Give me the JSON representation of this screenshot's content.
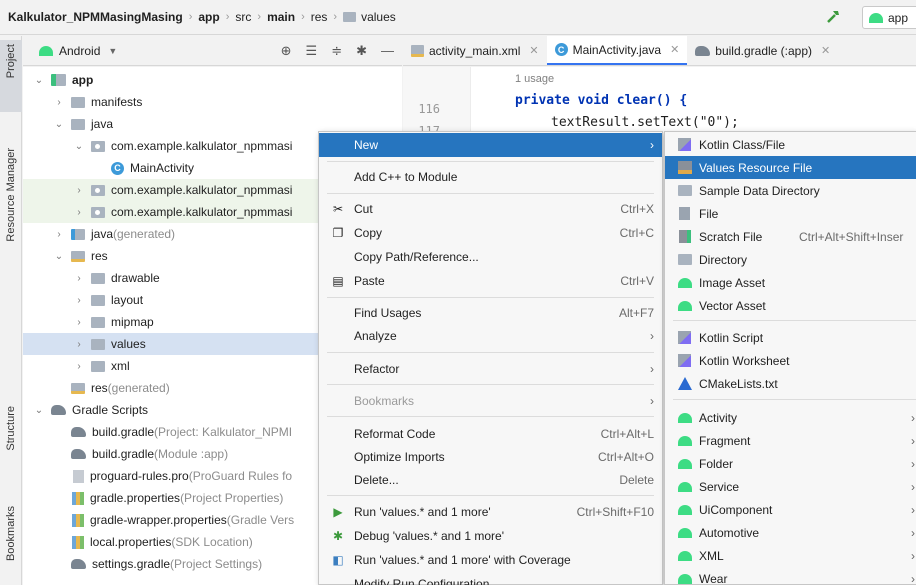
{
  "breadcrumb": {
    "project": "Kalkulator_NPMMasingMasing",
    "items": [
      "app",
      "src",
      "main",
      "res",
      "values"
    ]
  },
  "run_config": {
    "label": "app"
  },
  "side_tabs": {
    "project": "Project",
    "resource_manager": "Resource Manager",
    "structure": "Structure",
    "bookmarks": "Bookmarks"
  },
  "panel": {
    "view": "Android"
  },
  "tree": [
    {
      "label": "app",
      "extra": ""
    },
    {
      "label": "manifests",
      "extra": ""
    },
    {
      "label": "java",
      "extra": ""
    },
    {
      "label": "com.example.kalkulator_npmmasi",
      "extra": ""
    },
    {
      "label": "MainActivity",
      "extra": ""
    },
    {
      "label": "com.example.kalkulator_npmmasi",
      "extra": ""
    },
    {
      "label": "com.example.kalkulator_npmmasi",
      "extra": ""
    },
    {
      "label": "java",
      "extra": " (generated)"
    },
    {
      "label": "res",
      "extra": ""
    },
    {
      "label": "drawable",
      "extra": ""
    },
    {
      "label": "layout",
      "extra": ""
    },
    {
      "label": "mipmap",
      "extra": ""
    },
    {
      "label": "values",
      "extra": ""
    },
    {
      "label": "xml",
      "extra": ""
    },
    {
      "label": "res",
      "extra": " (generated)"
    },
    {
      "label": "Gradle Scripts",
      "extra": ""
    },
    {
      "label": "build.gradle",
      "extra": " (Project: Kalkulator_NPMI"
    },
    {
      "label": "build.gradle",
      "extra": " (Module :app)"
    },
    {
      "label": "proguard-rules.pro",
      "extra": " (ProGuard Rules fo"
    },
    {
      "label": "gradle.properties",
      "extra": " (Project Properties)"
    },
    {
      "label": "gradle-wrapper.properties",
      "extra": " (Gradle Vers"
    },
    {
      "label": "local.properties",
      "extra": " (SDK Location)"
    },
    {
      "label": "settings.gradle",
      "extra": " (Project Settings)"
    }
  ],
  "tabs": [
    {
      "label": "activity_main.xml"
    },
    {
      "label": "MainActivity.java"
    },
    {
      "label": "build.gradle (:app)"
    }
  ],
  "editor": {
    "usage": "1 usage",
    "line_116": "116",
    "line_117": "117",
    "code_1": "private void clear() {",
    "code_2": "textResult.setText(\"0\");"
  },
  "context_menu": [
    {
      "label": "New",
      "shortcut": "",
      "submenu": true
    },
    {
      "label": "Add C++ to Module",
      "shortcut": ""
    },
    {
      "label": "Cut",
      "shortcut": "Ctrl+X",
      "icon": "cut-icon"
    },
    {
      "label": "Copy",
      "shortcut": "Ctrl+C",
      "icon": "copy-icon"
    },
    {
      "label": "Copy Path/Reference...",
      "shortcut": ""
    },
    {
      "label": "Paste",
      "shortcut": "Ctrl+V",
      "icon": "paste-icon"
    },
    {
      "label": "Find Usages",
      "shortcut": "Alt+F7"
    },
    {
      "label": "Analyze",
      "shortcut": "",
      "submenu": true
    },
    {
      "label": "Refactor",
      "shortcut": "",
      "submenu": true
    },
    {
      "label": "Bookmarks",
      "shortcut": "",
      "submenu": true
    },
    {
      "label": "Reformat Code",
      "shortcut": "Ctrl+Alt+L"
    },
    {
      "label": "Optimize Imports",
      "shortcut": "Ctrl+Alt+O"
    },
    {
      "label": "Delete...",
      "shortcut": "Delete"
    },
    {
      "label": "Run 'values.* and 1 more'",
      "shortcut": "Ctrl+Shift+F10",
      "icon": "run-icon"
    },
    {
      "label": "Debug 'values.* and 1 more'",
      "shortcut": "",
      "icon": "debug-icon"
    },
    {
      "label": "Run 'values.* and 1 more' with Coverage",
      "shortcut": "",
      "icon": "coverage-icon"
    },
    {
      "label": "Modify Run Configuration...",
      "shortcut": ""
    }
  ],
  "submenu": [
    {
      "label": "Kotlin Class/File",
      "shortcut": ""
    },
    {
      "label": "Values Resource File",
      "shortcut": ""
    },
    {
      "label": "Sample Data Directory",
      "shortcut": ""
    },
    {
      "label": "File",
      "shortcut": ""
    },
    {
      "label": "Scratch File",
      "shortcut": "Ctrl+Alt+Shift+Inser"
    },
    {
      "label": "Directory",
      "shortcut": ""
    },
    {
      "label": "Image Asset",
      "shortcut": ""
    },
    {
      "label": "Vector Asset",
      "shortcut": ""
    },
    {
      "label": "Kotlin Script",
      "shortcut": ""
    },
    {
      "label": "Kotlin Worksheet",
      "shortcut": ""
    },
    {
      "label": "CMakeLists.txt",
      "shortcut": ""
    },
    {
      "label": "Activity",
      "shortcut": ""
    },
    {
      "label": "Fragment",
      "shortcut": ""
    },
    {
      "label": "Folder",
      "shortcut": ""
    },
    {
      "label": "Service",
      "shortcut": ""
    },
    {
      "label": "UiComponent",
      "shortcut": ""
    },
    {
      "label": "Automotive",
      "shortcut": ""
    },
    {
      "label": "XML",
      "shortcut": ""
    },
    {
      "label": "Wear",
      "shortcut": ""
    }
  ],
  "colors": {
    "selection": "#2675bf",
    "tree_selected": "#d5e1f2",
    "android_green": "#3ddc84",
    "keyword": "#0033b3"
  }
}
